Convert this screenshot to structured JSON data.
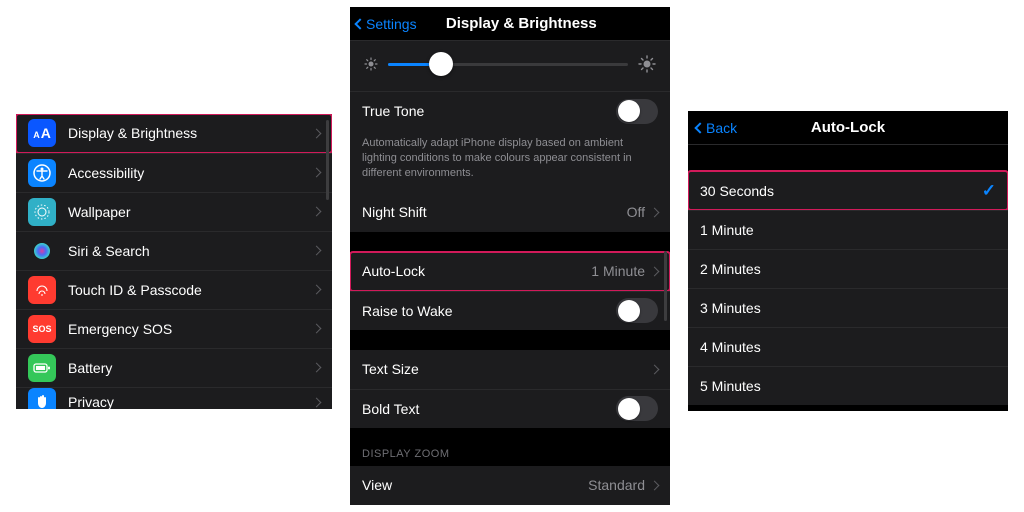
{
  "panel1": {
    "items": [
      {
        "label": "Display & Brightness",
        "icon": "text-size",
        "color": "#0a57ff"
      },
      {
        "label": "Accessibility",
        "icon": "accessibility",
        "color": "#0a84ff"
      },
      {
        "label": "Wallpaper",
        "icon": "wallpaper",
        "color": "#0a84ff"
      },
      {
        "label": "Siri & Search",
        "icon": "siri",
        "color": "#111"
      },
      {
        "label": "Touch ID & Passcode",
        "icon": "touchid",
        "color": "#ff3b30"
      },
      {
        "label": "Emergency SOS",
        "icon": "sos",
        "color": "#ff3b30"
      },
      {
        "label": "Battery",
        "icon": "battery",
        "color": "#34c759"
      },
      {
        "label": "Privacy",
        "icon": "hand",
        "color": "#0a84ff"
      }
    ]
  },
  "panel2": {
    "back": "Settings",
    "title": "Display & Brightness",
    "trueTone": {
      "label": "True Tone",
      "on": false
    },
    "trueToneHint": "Automatically adapt iPhone display based on ambient lighting conditions to make colours appear consistent in different environments.",
    "nightShift": {
      "label": "Night Shift",
      "value": "Off"
    },
    "autoLock": {
      "label": "Auto-Lock",
      "value": "1 Minute"
    },
    "raiseToWake": {
      "label": "Raise to Wake",
      "on": false
    },
    "textSize": {
      "label": "Text Size"
    },
    "boldText": {
      "label": "Bold Text",
      "on": false
    },
    "displayZoomHeader": "DISPLAY ZOOM",
    "view": {
      "label": "View",
      "value": "Standard"
    }
  },
  "panel3": {
    "back": "Back",
    "title": "Auto-Lock",
    "options": [
      {
        "label": "30 Seconds",
        "selected": true
      },
      {
        "label": "1 Minute",
        "selected": false
      },
      {
        "label": "2 Minutes",
        "selected": false
      },
      {
        "label": "3 Minutes",
        "selected": false
      },
      {
        "label": "4 Minutes",
        "selected": false
      },
      {
        "label": "5 Minutes",
        "selected": false
      }
    ]
  },
  "iconGlyphs": {
    "text-size": "AA",
    "sos": "SOS"
  }
}
